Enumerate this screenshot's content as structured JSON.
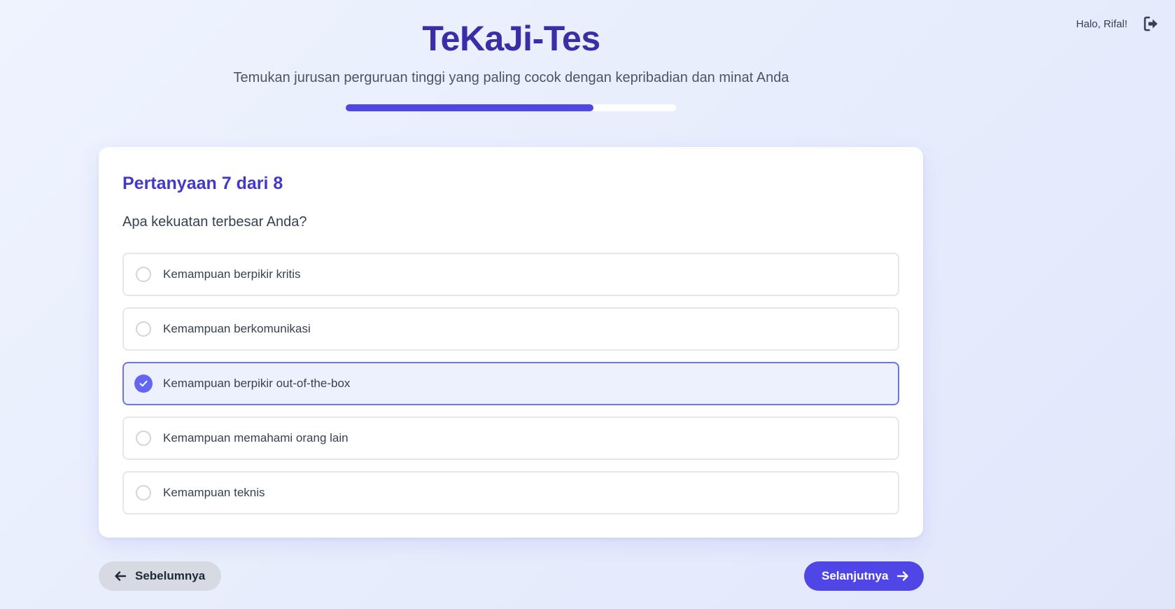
{
  "user": {
    "greeting": "Halo, Rifal!",
    "logout_icon": "logout-icon"
  },
  "header": {
    "title": "TeKaJi-Tes",
    "subtitle": "Temukan jurusan perguruan tinggi yang paling cocok dengan kepribadian dan minat Anda"
  },
  "progress": {
    "fraction": 0.75
  },
  "question": {
    "number_label": "Pertanyaan 7 dari 8",
    "text": "Apa kekuatan terbesar Anda?",
    "options": [
      {
        "label": "Kemampuan berpikir kritis",
        "selected": false
      },
      {
        "label": "Kemampuan berkomunikasi",
        "selected": false
      },
      {
        "label": "Kemampuan berpikir out-of-the-box",
        "selected": true
      },
      {
        "label": "Kemampuan memahami orang lain",
        "selected": false
      },
      {
        "label": "Kemampuan teknis",
        "selected": false
      }
    ]
  },
  "navigation": {
    "prev_label": "Sebelumnya",
    "next_label": "Selanjutnya",
    "prev_icon": "arrow-left-icon",
    "next_icon": "arrow-right-icon"
  },
  "colors": {
    "accent": "#4f46e5",
    "title": "#3a2ea6",
    "selected_border": "#6b76e8",
    "selected_bg": "#edf1fd"
  }
}
